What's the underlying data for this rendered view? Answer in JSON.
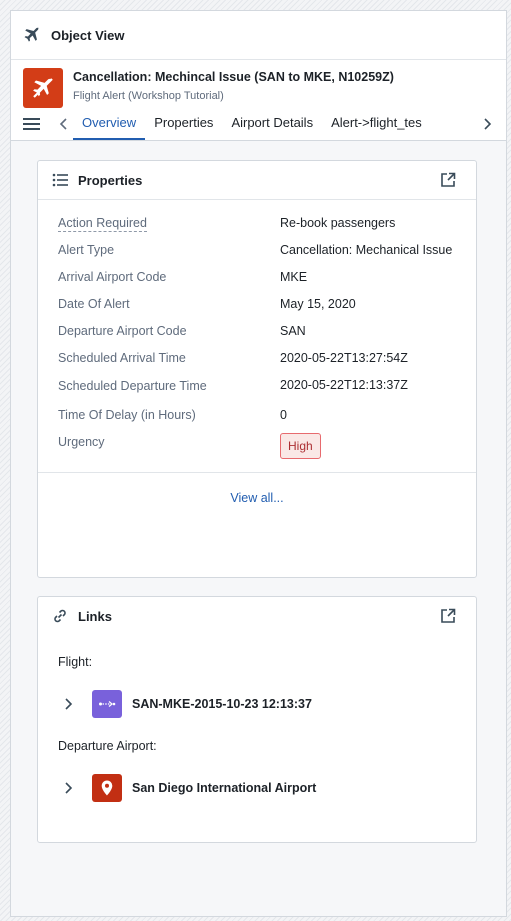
{
  "topbar": {
    "title": "Object View",
    "icon": "airplane-icon"
  },
  "object": {
    "title": "Cancellation: Mechincal Issue (SAN to MKE, N10259Z)",
    "subtitle": "Flight Alert (Workshop Tutorial)",
    "icon_color": "#d33d17"
  },
  "tabs": [
    "Overview",
    "Properties",
    "Airport Details",
    "Alert->flight_tes"
  ],
  "active_tab": "Overview",
  "properties_card": {
    "title": "Properties",
    "rows": [
      {
        "key": "Action Required",
        "value": "Re-book passengers"
      },
      {
        "key": "Alert Type",
        "value": "Cancellation: Mechanical Issue"
      },
      {
        "key": "Arrival Airport Code",
        "value": "MKE"
      },
      {
        "key": "Date Of Alert",
        "value": "May 15, 2020"
      },
      {
        "key": "Departure Airport Code",
        "value": "SAN"
      },
      {
        "key": "Scheduled Arrival Time",
        "value": "2020-05-22T13:27:54Z"
      },
      {
        "key": "Scheduled Departure Time",
        "value": "2020-05-22T12:13:37Z"
      },
      {
        "key": "Time Of Delay (in Hours)",
        "value": "0"
      },
      {
        "key": "Urgency",
        "value": "High"
      }
    ],
    "view_all": "View all..."
  },
  "links_card": {
    "title": "Links",
    "groups": [
      {
        "label": "Flight:",
        "item": "SAN-MKE-2015-10-23 12:13:37",
        "icon": "flight-route-icon",
        "icon_color": "#7961db"
      },
      {
        "label": "Departure Airport:",
        "item": "San Diego International Airport",
        "icon": "map-marker-icon",
        "icon_color": "#c22f13"
      }
    ]
  },
  "colors": {
    "accent": "#215db0",
    "urgency_bg": "#fae8e6",
    "urgency_border": "#e76a6e",
    "urgency_text": "#ac2f33"
  }
}
